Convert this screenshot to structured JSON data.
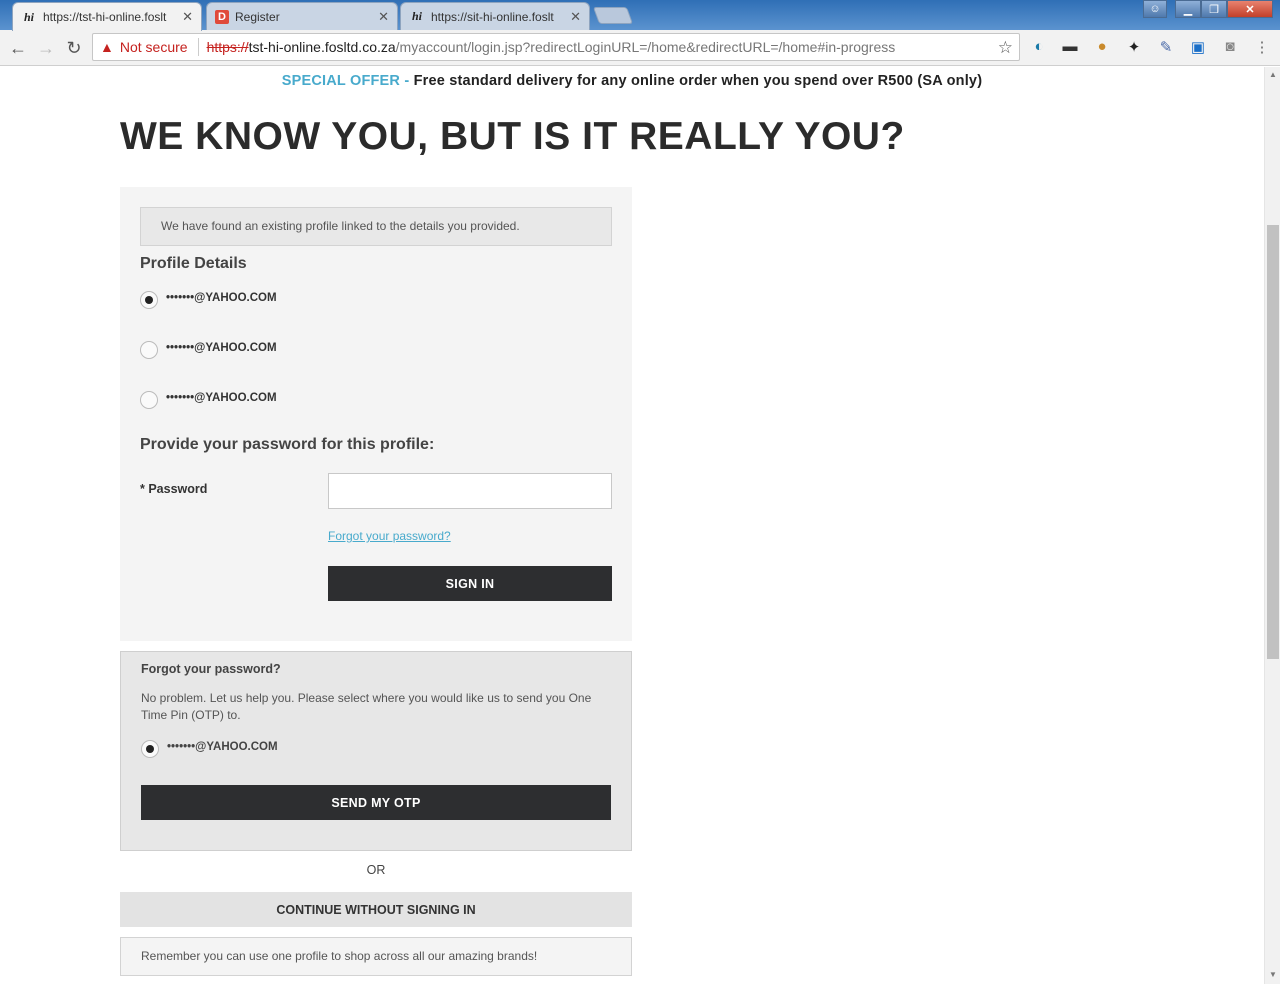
{
  "browser": {
    "tabs": [
      {
        "title": "https://tst-hi-online.foslt",
        "favicon": "hi",
        "active": true
      },
      {
        "title": "Register",
        "favicon": "D",
        "active": false
      },
      {
        "title": "https://sit-hi-online.foslt",
        "favicon": "hi",
        "active": false
      }
    ],
    "security_label": "Not secure",
    "url_scheme": "https://",
    "url_host": "tst-hi-online.fosltd.co.za",
    "url_path": "/myaccount/login.jsp?redirectLoginURL=/home&redirectURL=/home#in-progress"
  },
  "promo": {
    "offer_label": "SPECIAL OFFER",
    "separator": "-",
    "text": "Free standard delivery for any online order when you spend over R500 (SA only)"
  },
  "page_title": "WE KNOW YOU, BUT IS IT REALLY YOU?",
  "notice": "We have found an existing profile linked to the details you provided.",
  "profile": {
    "title": "Profile Details",
    "options": [
      {
        "label": "•••••••@YAHOO.COM",
        "selected": true
      },
      {
        "label": "•••••••@YAHOO.COM",
        "selected": false
      },
      {
        "label": "•••••••@YAHOO.COM",
        "selected": false
      }
    ]
  },
  "password_section": {
    "title": "Provide your password for this profile:",
    "field_label": "* Password",
    "value": "",
    "forgot_link": "Forgot your password?",
    "sign_in_label": "SIGN IN"
  },
  "forgot": {
    "title": "Forgot your password?",
    "text": "No problem. Let us help you. Please select where you would like us to send you One Time Pin (OTP) to.",
    "option": {
      "label": "•••••••@YAHOO.COM",
      "selected": true
    },
    "button_label": "SEND MY OTP"
  },
  "or_label": "OR",
  "continue_label": "CONTINUE WITHOUT SIGNING IN",
  "remember": "Remember you can use one profile to shop across all our amazing brands!",
  "colors": {
    "accent": "#48aacc",
    "button_dark": "#2d2e30",
    "warning": "#c5221f"
  }
}
